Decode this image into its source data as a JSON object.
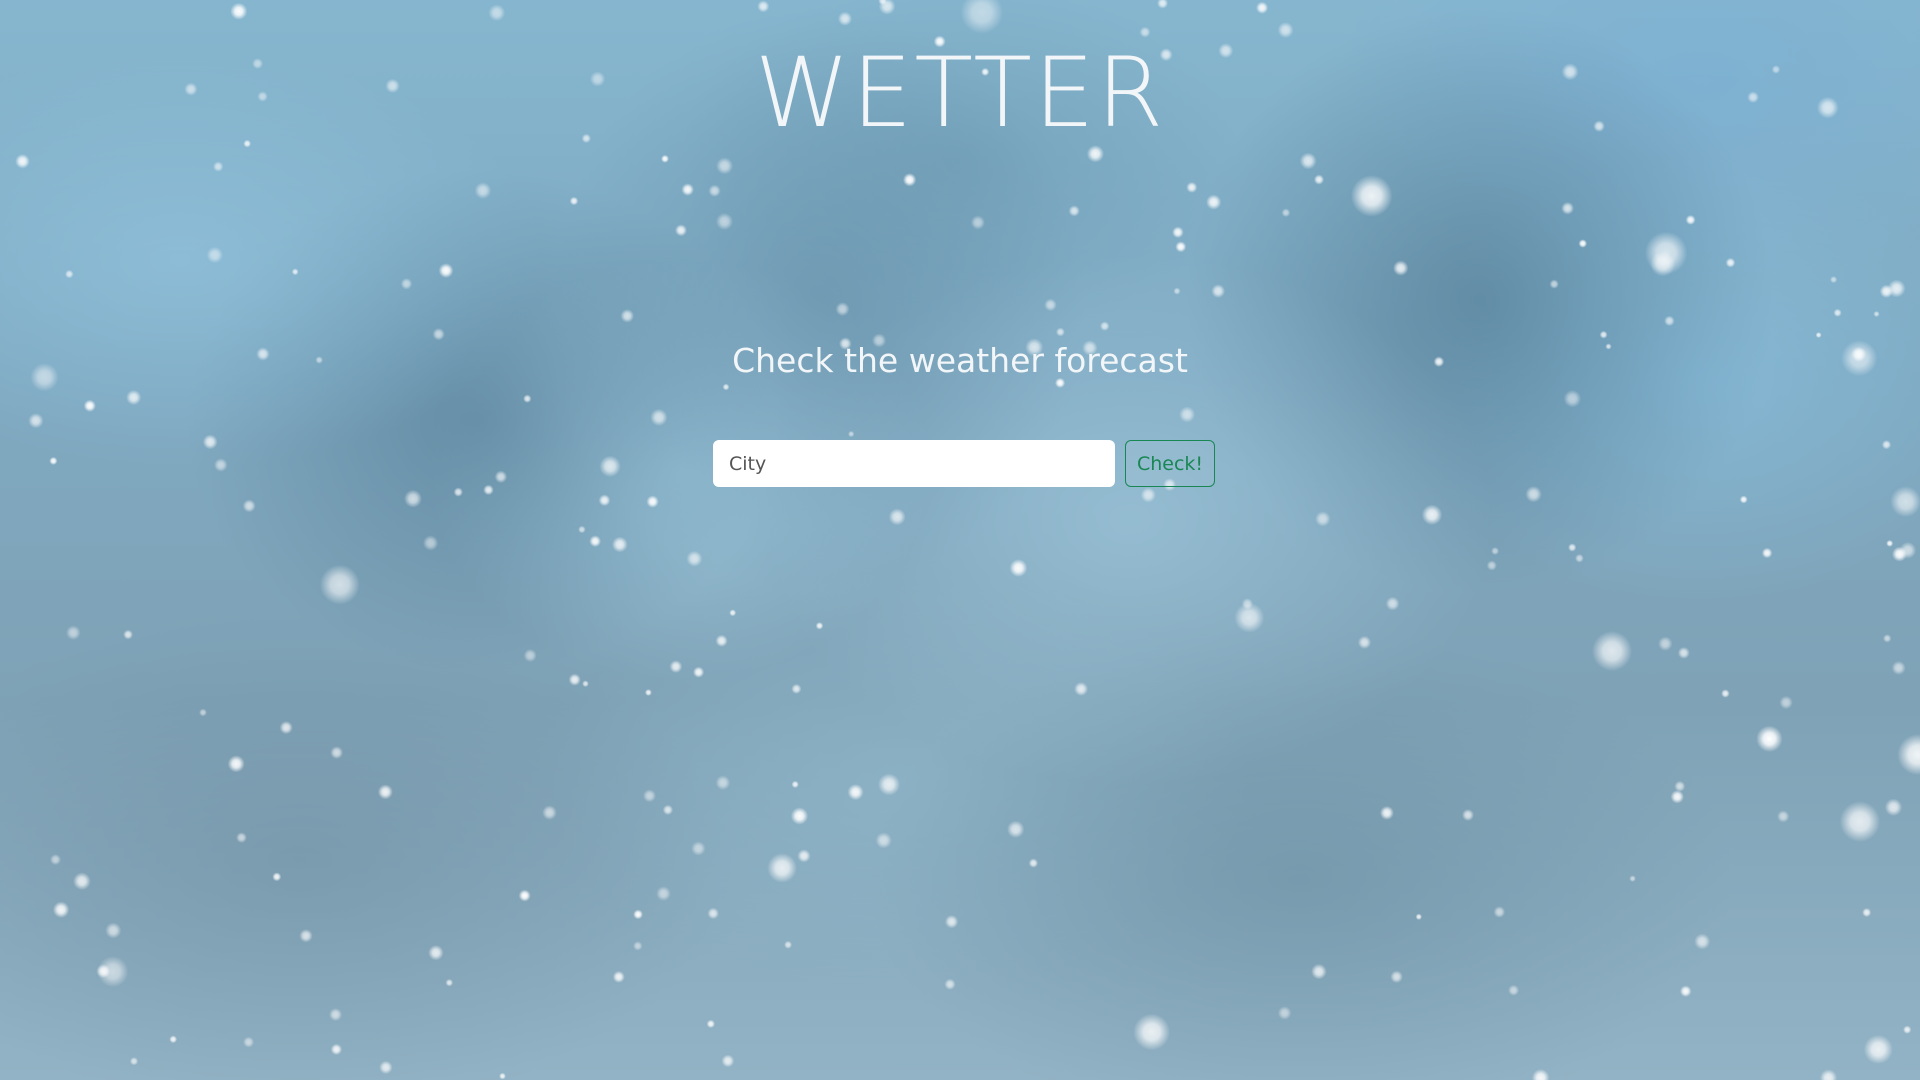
{
  "header": {
    "title": "WETTER"
  },
  "main": {
    "subtitle": "Check the weather forecast"
  },
  "search": {
    "placeholder": "City",
    "value": "",
    "button_label": "Check!"
  },
  "colors": {
    "button_accent": "#198754",
    "text": "#f3f6f8"
  }
}
